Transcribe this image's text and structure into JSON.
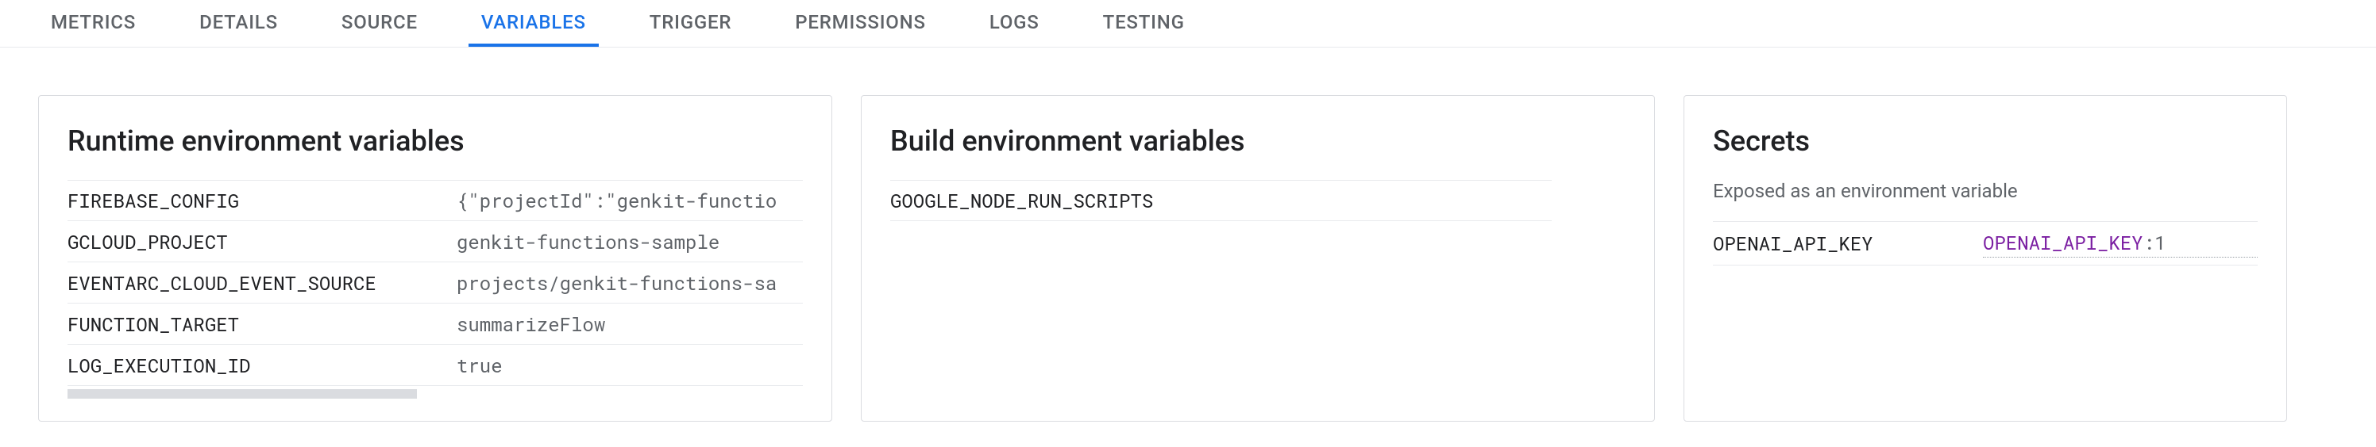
{
  "tabs": [
    {
      "label": "METRICS",
      "active": false
    },
    {
      "label": "DETAILS",
      "active": false
    },
    {
      "label": "SOURCE",
      "active": false
    },
    {
      "label": "VARIABLES",
      "active": true
    },
    {
      "label": "TRIGGER",
      "active": false
    },
    {
      "label": "PERMISSIONS",
      "active": false
    },
    {
      "label": "LOGS",
      "active": false
    },
    {
      "label": "TESTING",
      "active": false
    }
  ],
  "runtime": {
    "title": "Runtime environment variables",
    "rows": [
      {
        "key": "FIREBASE_CONFIG",
        "value": "{\"projectId\":\"genkit-functio"
      },
      {
        "key": "GCLOUD_PROJECT",
        "value": "genkit-functions-sample"
      },
      {
        "key": "EVENTARC_CLOUD_EVENT_SOURCE",
        "value": "projects/genkit-functions-sa"
      },
      {
        "key": "FUNCTION_TARGET",
        "value": "summarizeFlow"
      },
      {
        "key": "LOG_EXECUTION_ID",
        "value": "true"
      }
    ]
  },
  "build": {
    "title": "Build environment variables",
    "rows": [
      {
        "key": "GOOGLE_NODE_RUN_SCRIPTS",
        "value": ""
      }
    ]
  },
  "secrets": {
    "title": "Secrets",
    "subtitle": "Exposed as an environment variable",
    "rows": [
      {
        "key": "OPENAI_API_KEY",
        "link": "OPENAI_API_KEY",
        "suffix": ":1"
      }
    ]
  }
}
